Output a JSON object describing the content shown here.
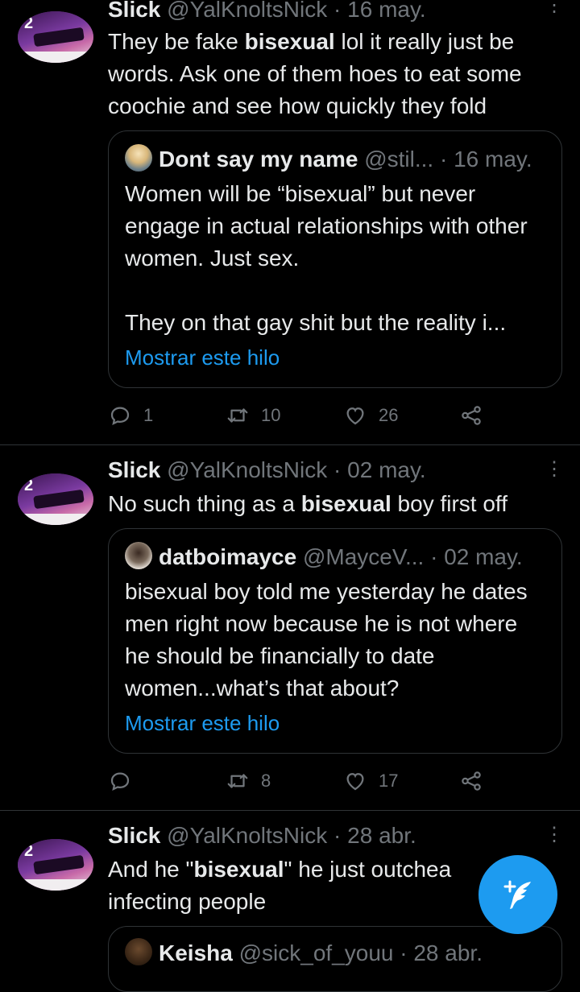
{
  "tweets": [
    {
      "name": "Slick",
      "handle": "@YalKnoltsNick",
      "sep": "·",
      "date": "16 may.",
      "text_a": "They be fake ",
      "text_bold": "bisexual",
      "text_b": " lol it really just be words. Ask one of them hoes to eat some coochie and see how quickly they fold",
      "quote": {
        "name": "Dont say my name",
        "handle": "@stil...",
        "sep": "·",
        "date": "16 may.",
        "text": "Women will be “bisexual” but never engage in actual relationships with other women. Just sex.\n\nThey on that gay shit but the reality i...",
        "link": "Mostrar este hilo"
      },
      "replies": "1",
      "retweets": "10",
      "likes": "26"
    },
    {
      "name": "Slick",
      "handle": "@YalKnoltsNick",
      "sep": "·",
      "date": "02 may.",
      "text_a": "No such thing as a ",
      "text_bold": "bisexual",
      "text_b": " boy first off",
      "quote": {
        "name": "datboimayce",
        "handle": "@MayceV...",
        "sep": "·",
        "date": "02 may.",
        "text": "bisexual boy told me yesterday he dates men right now because he is not where he should be financially to date women...what’s that about?",
        "link": "Mostrar este hilo"
      },
      "replies": "",
      "retweets": "8",
      "likes": "17"
    },
    {
      "name": "Slick",
      "handle": "@YalKnoltsNick",
      "sep": "·",
      "date": "28 abr.",
      "text_a": "And he \"",
      "text_bold": "bisexual",
      "text_b": "\" he just outchea infecting people",
      "quote": {
        "name": "Keisha",
        "handle": "@sick_of_youu",
        "sep": "·",
        "date": "28 abr."
      }
    }
  ],
  "colors": {
    "background": "#000000",
    "text": "#e7e9ea",
    "secondary": "#71767b",
    "accent": "#1d9bf0",
    "border": "#2f3336"
  },
  "icons": {
    "more": "more-dots-icon",
    "reply": "reply-icon",
    "retweet": "retweet-icon",
    "like": "heart-icon",
    "share": "share-icon",
    "compose": "compose-feather-icon"
  }
}
